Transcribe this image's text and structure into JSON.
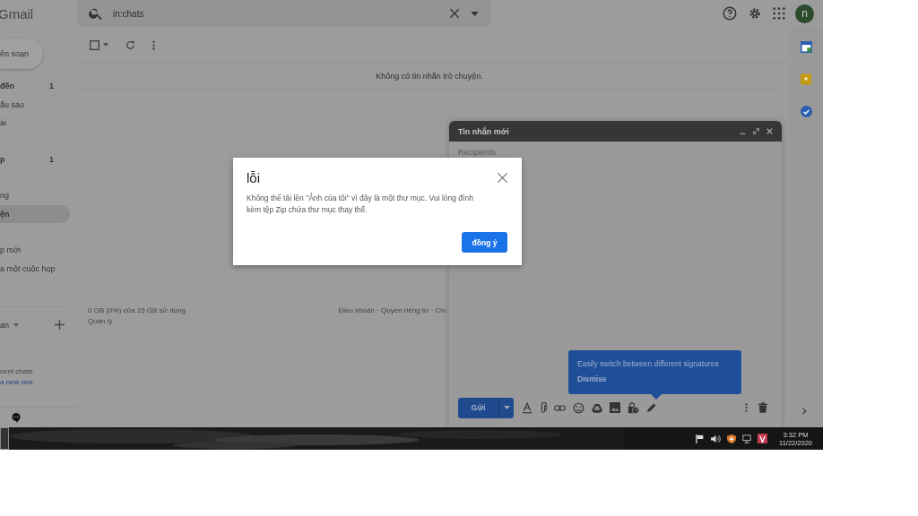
{
  "header": {
    "logo": "Gmail",
    "search": {
      "value": "in:chats"
    },
    "avatar": "n"
  },
  "sidebar": {
    "compose": "ên soạn",
    "sections": [
      [
        {
          "label": "đến",
          "count": "1",
          "unread": true,
          "selected": false
        },
        {
          "label": "ấu sao",
          "unread": false,
          "selected": false
        },
        {
          "label": "ai",
          "unread": false,
          "selected": false
        }
      ],
      [
        {
          "label": "p",
          "count": "1",
          "unread": true,
          "selected": false
        }
      ],
      [
        {
          "label": "ng",
          "unread": false,
          "selected": false
        },
        {
          "label": "ện",
          "unread": true,
          "selected": true
        }
      ],
      [
        {
          "label": "p mới",
          "unread": false,
          "selected": false
        },
        {
          "label": "a một cuộc họp",
          "unread": false,
          "selected": false
        }
      ]
    ],
    "chat_header": "an",
    "chats_note": "cent chats",
    "chats_link": "a new one"
  },
  "main": {
    "empty_message": "Không có tin nhắn trò chuyện.",
    "storage": "0 GB (0%) của 15 GB sử dụng",
    "manage": "Quản lý",
    "footer_links": "Điều khoản · Quyền riêng tư · Chí"
  },
  "compose": {
    "title": "Tin nhắn mới",
    "recipients_placeholder": "Recipients",
    "send": "Gửi",
    "tooltip": {
      "text": "Easily switch between different signatures",
      "dismiss": "Dismiss"
    }
  },
  "dialog": {
    "title": "lỗi",
    "message": "Không thể tải lên \"Ảnh của tôi\" vì đây là một thư mục. Vui lòng đính kèm tệp Zip chứa thư mục thay thế.",
    "button": "đồng ý"
  },
  "taskbar": {
    "time": "3:32 PM",
    "date": "11/22/2020"
  }
}
